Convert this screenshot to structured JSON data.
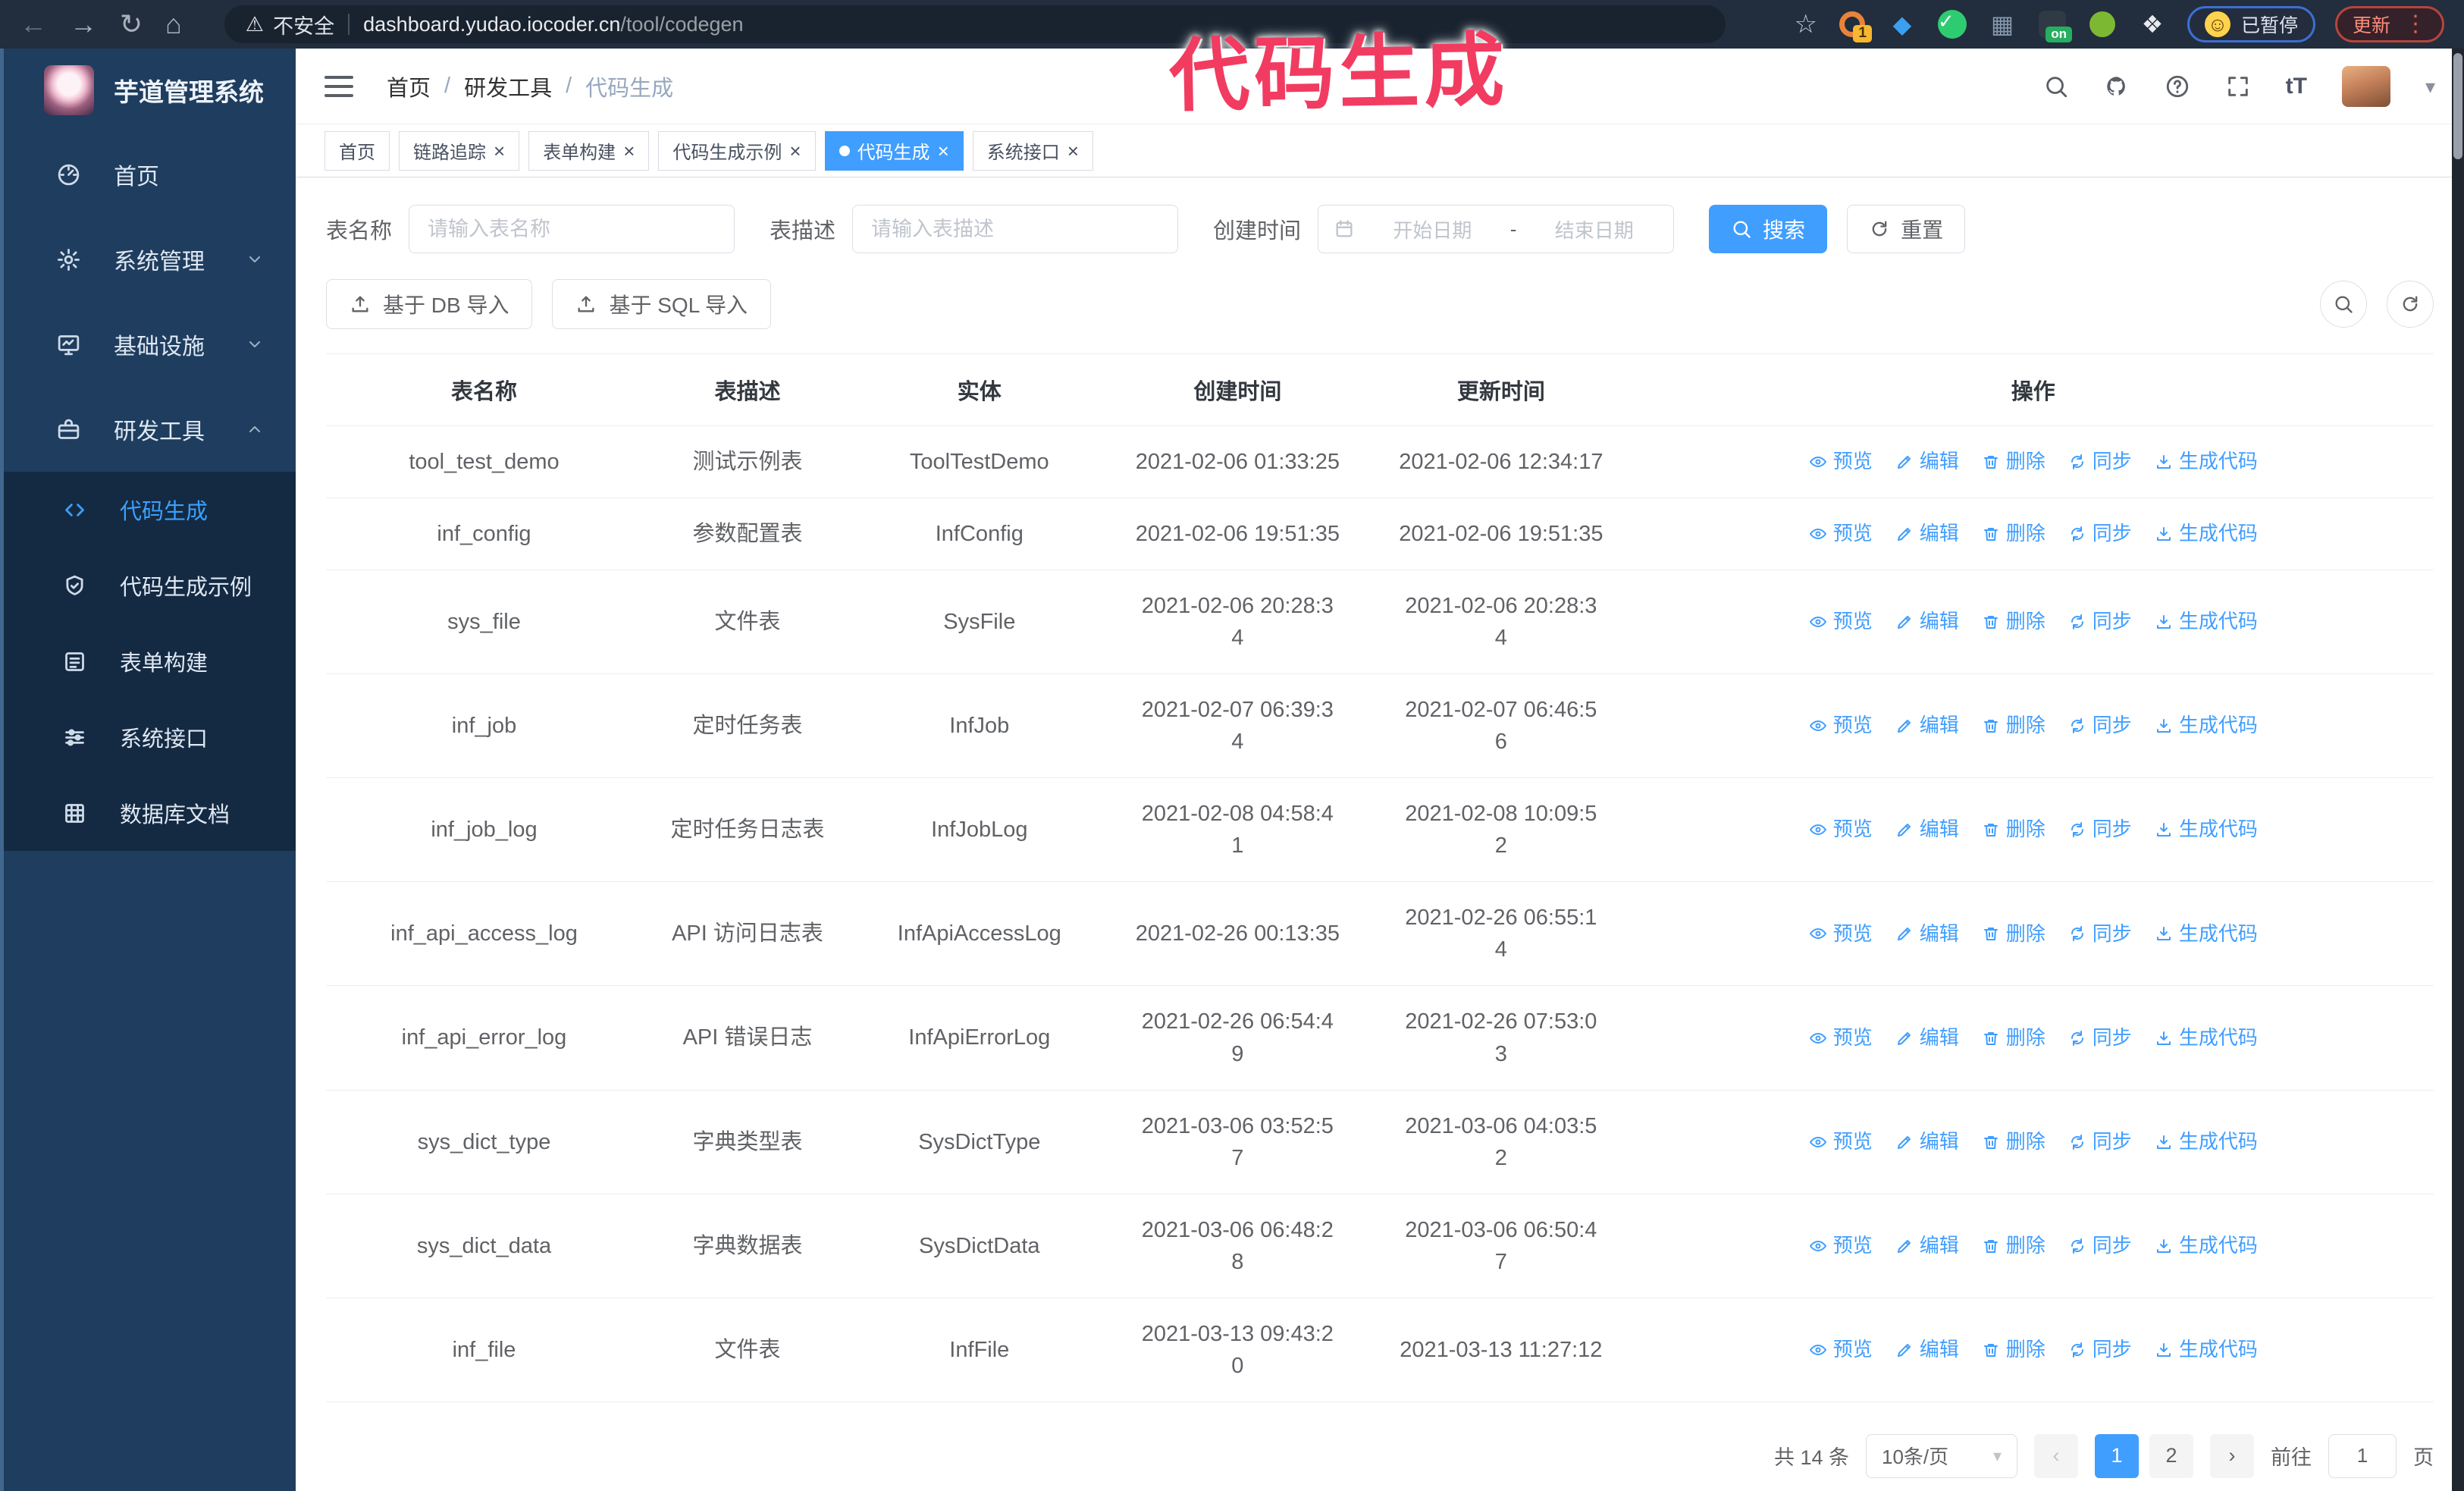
{
  "annotation": "代码生成",
  "browser": {
    "security": "不安全",
    "url_domain": "dashboard.yudao.iocoder.cn",
    "url_path": "/tool/codegen",
    "ext_badge_1": "1",
    "ext_badge_on": "on",
    "paused": "已暂停",
    "update": "更新"
  },
  "sidebar": {
    "title": "芋道管理系统",
    "items": [
      {
        "label": "首页",
        "icon": "dashboard-icon"
      },
      {
        "label": "系统管理",
        "icon": "gear-icon",
        "chevron": "down"
      },
      {
        "label": "基础设施",
        "icon": "monitor-icon",
        "chevron": "down"
      },
      {
        "label": "研发工具",
        "icon": "toolbox-icon",
        "chevron": "up",
        "expanded": true
      }
    ],
    "submenu": [
      {
        "label": "代码生成",
        "icon": "code-icon",
        "active": true
      },
      {
        "label": "代码生成示例",
        "icon": "shield-check-icon"
      },
      {
        "label": "表单构建",
        "icon": "form-icon"
      },
      {
        "label": "系统接口",
        "icon": "sliders-icon"
      },
      {
        "label": "数据库文档",
        "icon": "database-icon"
      }
    ]
  },
  "header": {
    "breadcrumb": [
      "首页",
      "研发工具",
      "代码生成"
    ],
    "separator": "/"
  },
  "tabs": [
    {
      "label": "首页",
      "closable": false
    },
    {
      "label": "链路追踪",
      "closable": true
    },
    {
      "label": "表单构建",
      "closable": true
    },
    {
      "label": "代码生成示例",
      "closable": true
    },
    {
      "label": "代码生成",
      "closable": true,
      "active": true
    },
    {
      "label": "系统接口",
      "closable": true
    }
  ],
  "filters": {
    "name_label": "表名称",
    "name_placeholder": "请输入表名称",
    "desc_label": "表描述",
    "desc_placeholder": "请输入表描述",
    "time_label": "创建时间",
    "start_placeholder": "开始日期",
    "range_separator": "-",
    "end_placeholder": "结束日期",
    "search_label": "搜索",
    "reset_label": "重置"
  },
  "toolbar": {
    "db_import": "基于 DB 导入",
    "sql_import": "基于 SQL 导入"
  },
  "table": {
    "columns": [
      "表名称",
      "表描述",
      "实体",
      "创建时间",
      "更新时间",
      "操作"
    ],
    "row_actions": [
      {
        "label": "预览",
        "icon": "eye-icon"
      },
      {
        "label": "编辑",
        "icon": "edit-icon"
      },
      {
        "label": "删除",
        "icon": "delete-icon"
      },
      {
        "label": "同步",
        "icon": "sync-icon"
      },
      {
        "label": "生成代码",
        "icon": "download-icon"
      }
    ],
    "rows": [
      {
        "name": "tool_test_demo",
        "desc": "测试示例表",
        "entity": "ToolTestDemo",
        "created": "2021-02-06 01:33:25",
        "updated": "2021-02-06 12:34:17"
      },
      {
        "name": "inf_config",
        "desc": "参数配置表",
        "entity": "InfConfig",
        "created": "2021-02-06 19:51:35",
        "updated": "2021-02-06 19:51:35"
      },
      {
        "name": "sys_file",
        "desc": "文件表",
        "entity": "SysFile",
        "created": "2021-02-06 20:28:3\n4",
        "updated": "2021-02-06 20:28:3\n4"
      },
      {
        "name": "inf_job",
        "desc": "定时任务表",
        "entity": "InfJob",
        "created": "2021-02-07 06:39:3\n4",
        "updated": "2021-02-07 06:46:5\n6"
      },
      {
        "name": "inf_job_log",
        "desc": "定时任务日志表",
        "entity": "InfJobLog",
        "created": "2021-02-08 04:58:4\n1",
        "updated": "2021-02-08 10:09:5\n2"
      },
      {
        "name": "inf_api_access_log",
        "desc": "API 访问日志表",
        "entity": "InfApiAccessLog",
        "created": "2021-02-26 00:13:35",
        "updated": "2021-02-26 06:55:1\n4"
      },
      {
        "name": "inf_api_error_log",
        "desc": "API 错误日志",
        "entity": "InfApiErrorLog",
        "created": "2021-02-26 06:54:4\n9",
        "updated": "2021-02-26 07:53:0\n3"
      },
      {
        "name": "sys_dict_type",
        "desc": "字典类型表",
        "entity": "SysDictType",
        "created": "2021-03-06 03:52:5\n7",
        "updated": "2021-03-06 04:03:5\n2"
      },
      {
        "name": "sys_dict_data",
        "desc": "字典数据表",
        "entity": "SysDictData",
        "created": "2021-03-06 06:48:2\n8",
        "updated": "2021-03-06 06:50:4\n7"
      },
      {
        "name": "inf_file",
        "desc": "文件表",
        "entity": "InfFile",
        "created": "2021-03-13 09:43:2\n0",
        "updated": "2021-03-13 11:27:12"
      }
    ]
  },
  "pagination": {
    "total": "共 14 条",
    "page_size": "10条/页",
    "pages": [
      "1",
      "2"
    ],
    "active_page": "1",
    "goto_label": "前往",
    "goto_value": "1",
    "goto_unit": "页"
  }
}
